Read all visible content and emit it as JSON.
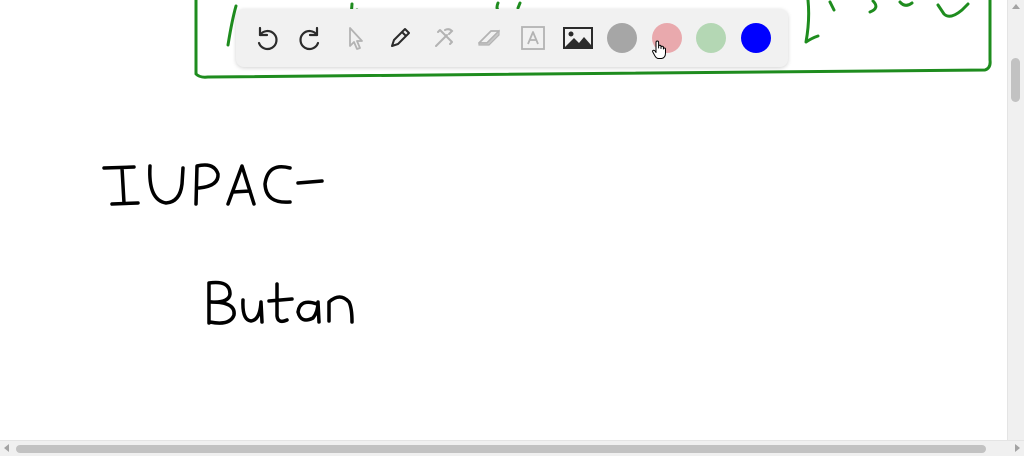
{
  "ink": {
    "line1": "IUPAC-",
    "line2": "Butan",
    "ink_color": "#000000",
    "box_color": "#1e8c1e"
  },
  "toolbar": {
    "tools": [
      {
        "name": "undo-icon",
        "enabled": true
      },
      {
        "name": "redo-icon",
        "enabled": true
      },
      {
        "name": "select-pointer-icon",
        "enabled": false
      },
      {
        "name": "pen-icon",
        "enabled": true
      },
      {
        "name": "tools-icon",
        "enabled": false
      },
      {
        "name": "eraser-icon",
        "enabled": false
      },
      {
        "name": "text-icon",
        "enabled": false
      },
      {
        "name": "image-icon",
        "enabled": true
      }
    ],
    "colors": [
      {
        "name": "gray",
        "hex": "#a6a6a6"
      },
      {
        "name": "pink",
        "hex": "#e9a9ad"
      },
      {
        "name": "light-green",
        "hex": "#b4d7b4"
      },
      {
        "name": "blue",
        "hex": "#0000ff"
      }
    ]
  }
}
